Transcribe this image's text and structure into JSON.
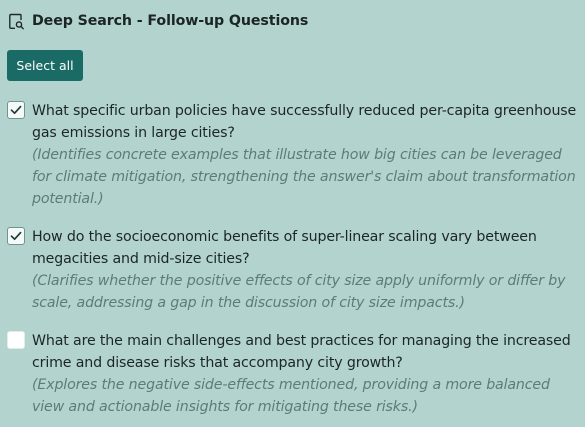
{
  "header": {
    "title": "Deep Search - Follow-up Questions",
    "icon": "search-document-icon"
  },
  "toolbar": {
    "select_all_label": "Select all"
  },
  "colors": {
    "background": "#b3d3cf",
    "accent": "#1a6b66",
    "rationale_text": "#5e7b78"
  },
  "questions": [
    {
      "checked": true,
      "question": "What specific urban policies have successfully reduced per-capita greenhouse gas emissions in large cities?",
      "rationale": "(Identifies concrete examples that illustrate how big cities can be leveraged for climate mitigation, strengthening the answer's claim about transformation potential.)"
    },
    {
      "checked": true,
      "question": "How do the socioeconomic benefits of super-linear scaling vary between megacities and mid-size cities?",
      "rationale": "(Clarifies whether the positive effects of city size apply uniformly or differ by scale, addressing a gap in the discussion of city size impacts.)"
    },
    {
      "checked": false,
      "question": "What are the main challenges and best practices for managing the increased crime and disease risks that accompany city growth?",
      "rationale": "(Explores the negative side-effects mentioned, providing a more balanced view and actionable insights for mitigating these risks.)"
    }
  ]
}
